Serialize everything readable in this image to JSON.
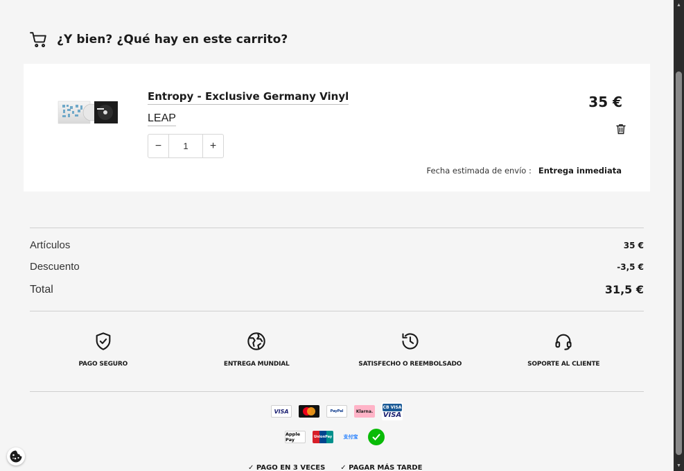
{
  "header": {
    "title": "¿Y bien? ¿Qué hay en este carrito?",
    "cart_icon": "shopping-cart-icon"
  },
  "item": {
    "name": "Entropy - Exclusive Germany Vinyl",
    "artist": "LEAP",
    "quantity": "1",
    "minus_label": "−",
    "plus_label": "+",
    "price": "35 €",
    "shipping_label": "Fecha estimada de envío :",
    "shipping_value": "Entrega inmediata"
  },
  "summary": {
    "articles_label": "Artículos",
    "articles_value": "35 €",
    "discount_label": "Descuento",
    "discount_value": "-3,5 €",
    "total_label": "Total",
    "total_value": "31,5 €"
  },
  "features": [
    {
      "label": "PAGO SEGURO",
      "icon": "shield-check-icon"
    },
    {
      "label": "ENTREGA MUNDIAL",
      "icon": "globe-icon"
    },
    {
      "label": "SATISFECHO O REEMBOLSADO",
      "icon": "history-icon"
    },
    {
      "label": "SOPORTE AL CLIENTE",
      "icon": "headset-icon"
    }
  ],
  "payments_row1": [
    {
      "name": "VISA",
      "color": "#1a1f71"
    },
    {
      "name": "mastercard",
      "color": "#eb001b"
    },
    {
      "name": "PayPal",
      "color": "#003087"
    },
    {
      "name": "Klarna.",
      "color": "#ffb3c7"
    },
    {
      "name": "CB VISA",
      "color": "#1a5a96"
    }
  ],
  "payments_row2": [
    {
      "name": "Apple Pay",
      "color": "#000000"
    },
    {
      "name": "UnionPay",
      "color": "#d71e28"
    },
    {
      "name": "支付宝",
      "color": "#1677ff"
    },
    {
      "name": "WeChat",
      "color": "#09bb07"
    }
  ],
  "options": [
    "PAGO EN 3 VECES",
    "PAGAR MÁS TARDE"
  ],
  "colors": {
    "background": "#f5f5f5",
    "card": "#ffffff",
    "text": "#1a1a1a",
    "divider": "#cfcfcf"
  }
}
